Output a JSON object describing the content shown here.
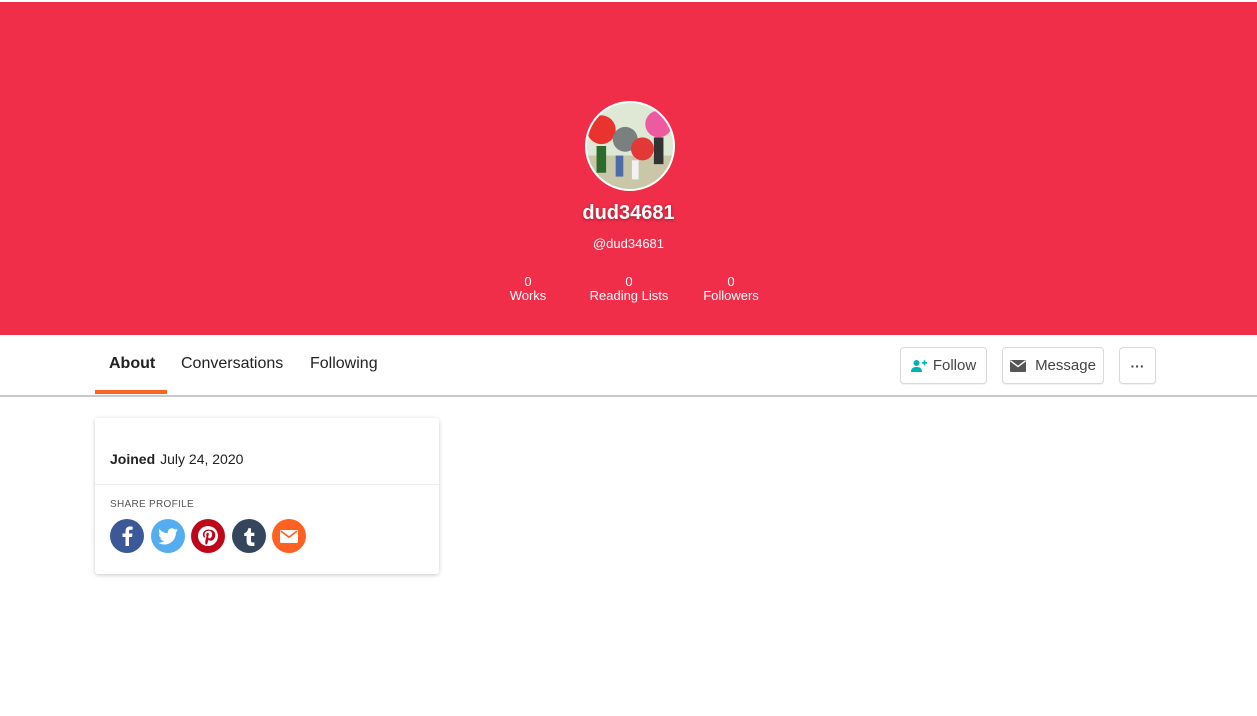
{
  "profile": {
    "display_name": "dud34681",
    "handle": "@dud34681",
    "stats": [
      {
        "value": "0",
        "label": "Works"
      },
      {
        "value": "0",
        "label": "Reading Lists"
      },
      {
        "value": "0",
        "label": "Followers"
      }
    ]
  },
  "nav": {
    "tabs": [
      {
        "label": "About",
        "active": true
      },
      {
        "label": "Conversations",
        "active": false
      },
      {
        "label": "Following",
        "active": false
      }
    ],
    "follow_label": "Follow",
    "message_label": "Message",
    "more_label": "···"
  },
  "about": {
    "joined_label": "Joined",
    "joined_date": "July 24, 2020",
    "share_title": "SHARE PROFILE",
    "share_icons": [
      "facebook-icon",
      "twitter-icon",
      "pinterest-icon",
      "tumblr-icon",
      "email-icon"
    ]
  },
  "colors": {
    "hero": "#f02e49",
    "accent": "#ff6122",
    "facebook": "#3b5998",
    "twitter": "#55acee",
    "pinterest": "#bd081c",
    "tumblr": "#35465c",
    "email": "#ff6122"
  }
}
